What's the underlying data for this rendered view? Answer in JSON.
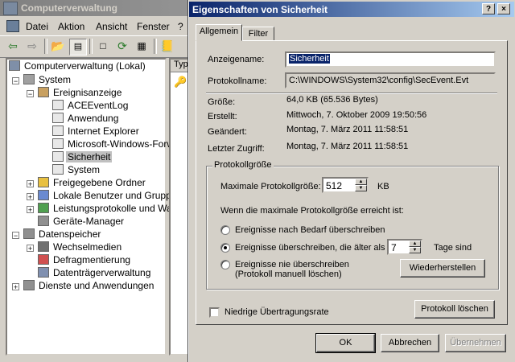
{
  "background_window": {
    "title": "Computerverwaltung",
    "menu": [
      "Datei",
      "Aktion",
      "Ansicht",
      "Fenster",
      "?"
    ],
    "list_header": "Typ",
    "tree": [
      {
        "label": "Computerverwaltung (Lokal)",
        "icon": "computer-icon",
        "color": "#7f8fa8"
      },
      {
        "label": "System",
        "icon": "tools-icon",
        "color": "#a0a0a0"
      },
      {
        "label": "Ereignisanzeige",
        "icon": "event-viewer-icon",
        "color": "#c8a060"
      },
      {
        "label": "ACEEventLog",
        "icon": "log-icon",
        "color": "#e8e8e8"
      },
      {
        "label": "Anwendung",
        "icon": "log-icon",
        "color": "#e8e8e8"
      },
      {
        "label": "Internet Explorer",
        "icon": "log-icon",
        "color": "#e8e8e8"
      },
      {
        "label": "Microsoft-Windows-Forw",
        "icon": "log-icon",
        "color": "#e8e8e8"
      },
      {
        "label": "Sicherheit",
        "icon": "log-icon",
        "color": "#e8e8e8"
      },
      {
        "label": "System",
        "icon": "log-icon",
        "color": "#e8e8e8"
      },
      {
        "label": "Freigegebene Ordner",
        "icon": "shared-folder-icon",
        "color": "#e8c040"
      },
      {
        "label": "Lokale Benutzer und Gruppe",
        "icon": "users-icon",
        "color": "#6a8ad0"
      },
      {
        "label": "Leistungsprotokolle und War",
        "icon": "performance-icon",
        "color": "#50a050"
      },
      {
        "label": "Geräte-Manager",
        "icon": "device-manager-icon",
        "color": "#909090"
      },
      {
        "label": "Datenspeicher",
        "icon": "storage-icon",
        "color": "#909090"
      },
      {
        "label": "Wechselmedien",
        "icon": "removable-media-icon",
        "color": "#707070"
      },
      {
        "label": "Defragmentierung",
        "icon": "defrag-icon",
        "color": "#d05050"
      },
      {
        "label": "Datenträgerverwaltung",
        "icon": "disk-management-icon",
        "color": "#8090b0"
      },
      {
        "label": "Dienste und Anwendungen",
        "icon": "services-icon",
        "color": "#909090"
      }
    ]
  },
  "dialog": {
    "title": "Eigenschaften von Sicherheit",
    "help_button": "?",
    "close_button": "×",
    "tabs": [
      "Allgemein",
      "Filter"
    ],
    "fields": {
      "anzeigename_label": "Anzeigename:",
      "anzeigename_value": "Sicherheit",
      "protokollname_label": "Protokollname:",
      "protokollname_value": "C:\\WINDOWS\\System32\\config\\SecEvent.Evt",
      "groesse_label": "Größe:",
      "groesse_value": "64,0 KB (65.536 Bytes)",
      "erstellt_label": "Erstellt:",
      "erstellt_value": "Mittwoch, 7. Oktober 2009 19:50:56",
      "geaendert_label": "Geändert:",
      "geaendert_value": "Montag, 7. März 2011 11:58:51",
      "letzter_zugriff_label": "Letzter Zugriff:",
      "letzter_zugriff_value": "Montag, 7. März 2011 11:58:51"
    },
    "group": {
      "title": "Protokollgröße",
      "max_label": "Maximale Protokollgröße:",
      "max_value": "512",
      "max_unit": "KB",
      "when_label": "Wenn die maximale Protokollgröße erreicht ist:",
      "radio1": "Ereignisse nach Bedarf überschreiben",
      "radio2": "Ereignisse überschreiben, die älter als",
      "radio2_days": "7",
      "radio2_unit": "Tage sind",
      "radio3_line1": "Ereignisse nie überschreiben",
      "radio3_line2": "(Protokoll manuell löschen)",
      "selected_radio": 2,
      "restore_button": "Wiederherstellen"
    },
    "low_speed_label": "Niedrige Übertragungsrate",
    "low_speed_checked": false,
    "clear_log_button": "Protokoll löschen",
    "ok_button": "OK",
    "cancel_button": "Abbrechen",
    "apply_button": "Übernehmen",
    "colors": {
      "title_active": "#0a246a",
      "title_inactive": "#808080",
      "face": "#d4d0c8",
      "selection": "#0a246a"
    }
  }
}
